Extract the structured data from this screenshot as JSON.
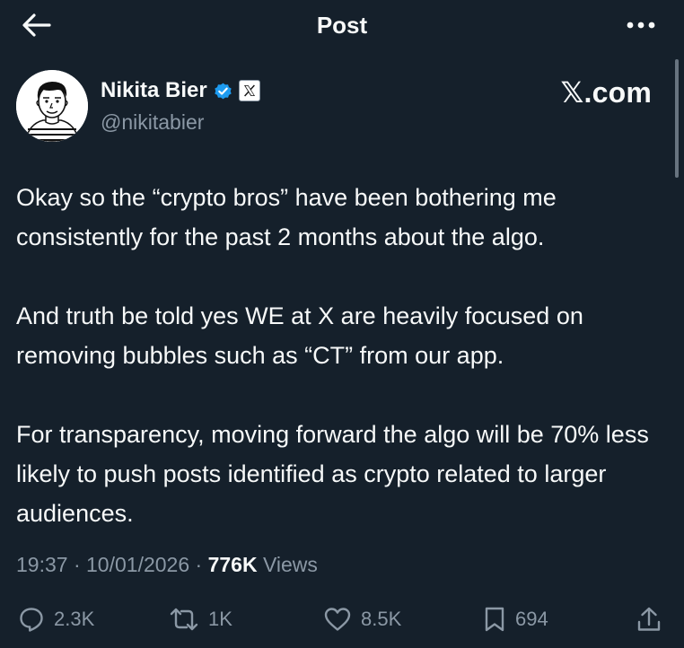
{
  "header": {
    "title": "Post"
  },
  "author": {
    "display_name": "Nikita Bier",
    "handle": "@nikitabier",
    "verified_color": "#1d9bf0",
    "affiliate_badge_icon": "x-logo-icon"
  },
  "brand": {
    "glyph": "𝕏",
    "text": ".com"
  },
  "post": {
    "paragraphs": [
      "Okay so the “crypto bros” have been bothering me consistently for the past 2 months about the algo.",
      "And truth be told yes WE at X are heavily focused on removing bubbles such as “CT” from our app.",
      "For transparency, moving forward the algo will be 70% less likely to push posts identified as crypto related to larger audiences."
    ],
    "time": "19:37",
    "date": "10/01/2026",
    "views_count": "776K",
    "views_label": "Views"
  },
  "actions": {
    "replies": {
      "icon": "reply-icon",
      "count": "2.3K"
    },
    "reposts": {
      "icon": "repost-icon",
      "count": "1K"
    },
    "likes": {
      "icon": "like-icon",
      "count": "8.5K"
    },
    "bookmarks": {
      "icon": "bookmark-icon",
      "count": "694"
    },
    "share": {
      "icon": "share-icon"
    }
  },
  "colors": {
    "background": "#15202b",
    "primary_text": "#f7f9f9",
    "secondary_text": "#8b98a5",
    "accent": "#1d9bf0"
  }
}
